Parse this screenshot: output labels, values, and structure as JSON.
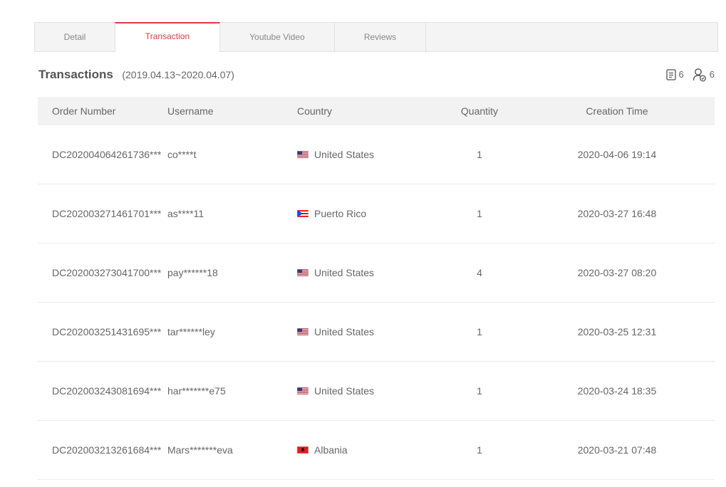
{
  "tabs": [
    {
      "label": "Detail",
      "active": false
    },
    {
      "label": "Transaction",
      "active": true
    },
    {
      "label": "Youtube Video",
      "active": false
    },
    {
      "label": "Reviews",
      "active": false
    }
  ],
  "heading": {
    "title": "Transactions",
    "date_range": "(2019.04.13~2020.04.07)"
  },
  "counters": {
    "orders": {
      "icon": "document-icon",
      "value": "6"
    },
    "buyers": {
      "icon": "user-check-icon",
      "value": "6"
    }
  },
  "table": {
    "headers": [
      "Order Number",
      "Username",
      "Country",
      "Quantity",
      "Creation Time"
    ],
    "rows": [
      {
        "order": "DC202004064261736***",
        "user": "co****t",
        "country": "United States",
        "flag": "us",
        "qty": "1",
        "time": "2020-04-06 19:14"
      },
      {
        "order": "DC202003271461701***",
        "user": "as****11",
        "country": "Puerto Rico",
        "flag": "pr",
        "qty": "1",
        "time": "2020-03-27 16:48"
      },
      {
        "order": "DC202003273041700***",
        "user": "pay******18",
        "country": "United States",
        "flag": "us",
        "qty": "4",
        "time": "2020-03-27 08:20"
      },
      {
        "order": "DC202003251431695***",
        "user": "tar******ley",
        "country": "United States",
        "flag": "us",
        "qty": "1",
        "time": "2020-03-25 12:31"
      },
      {
        "order": "DC202003243081694***",
        "user": "har*******e75",
        "country": "United States",
        "flag": "us",
        "qty": "1",
        "time": "2020-03-24 18:35"
      },
      {
        "order": "DC202003213261684***",
        "user": "Mars*******eva",
        "country": "Albania",
        "flag": "al",
        "qty": "1",
        "time": "2020-03-21 07:48"
      }
    ]
  },
  "colors": {
    "accent": "#e4393c",
    "header_bg": "#f2f2f2",
    "tab_bg": "#f4f4f4"
  }
}
